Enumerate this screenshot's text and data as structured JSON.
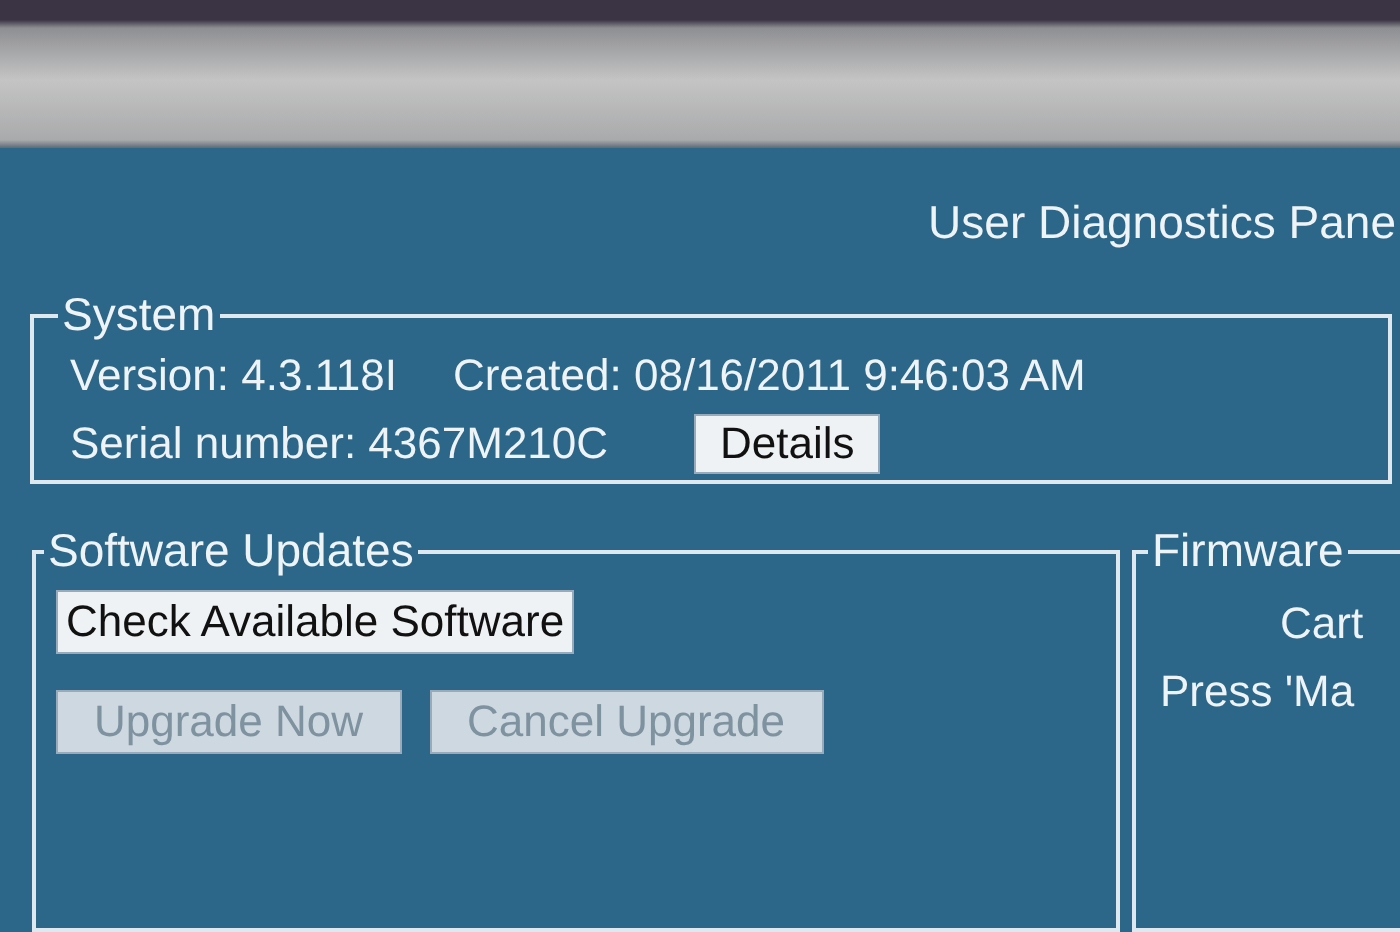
{
  "title": "User Diagnostics Pane",
  "system": {
    "legend": "System",
    "version": "Version: 4.3.118I",
    "created": "Created: 08/16/2011  9:46:03 AM",
    "serial": "Serial number: 4367M210C",
    "button": {
      "label": "Details",
      "disabled": false
    }
  },
  "software_updates": {
    "legend": "Software Updates",
    "buttons": [
      {
        "label": "Check Available Software",
        "disabled": false
      },
      {
        "label": "Upgrade Now",
        "disabled": true
      },
      {
        "label": "Cancel Upgrade",
        "disabled": true
      }
    ]
  },
  "firmware": {
    "legend": "Firmware",
    "lines": [
      "Cart",
      "Press 'Ma"
    ]
  }
}
